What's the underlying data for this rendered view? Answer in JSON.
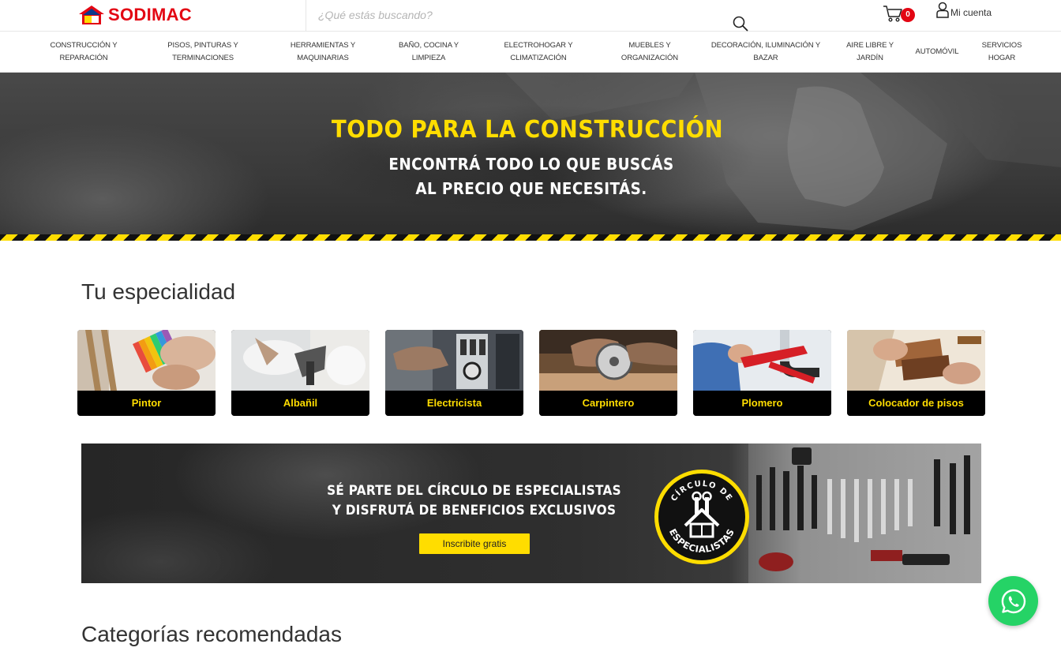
{
  "brand": {
    "name": "SODIMAC",
    "primary_color": "#e30613",
    "accent_color": "#ffdd00",
    "logo_icon": "house-icon"
  },
  "header": {
    "search_placeholder": "¿Qué estás buscando?",
    "search_icon": "search-icon",
    "cart_count": "0",
    "cart_icon": "cart-icon",
    "account_label": "Mi cuenta",
    "account_icon": "user-icon"
  },
  "categories": [
    {
      "line1": "CONSTRUCCIÓN Y",
      "line2": "REPARACIÓN"
    },
    {
      "line1": "PISOS, PINTURAS Y",
      "line2": "TERMINACIONES"
    },
    {
      "line1": "HERRAMIENTAS Y",
      "line2": "MAQUINARIAS"
    },
    {
      "line1": "BAÑO, COCINA Y",
      "line2": "LIMPIEZA"
    },
    {
      "line1": "ELECTROHOGAR Y",
      "line2": "CLIMATIZACIÓN"
    },
    {
      "line1": "MUEBLES Y",
      "line2": "ORGANIZACIÓN"
    },
    {
      "line1": "DECORACIÓN, ILUMINACIÓN Y",
      "line2": "BAZAR"
    },
    {
      "line1": "AIRE LIBRE Y",
      "line2": "JARDÍN"
    },
    {
      "line1": "AUTOMÓVIL",
      "line2": ""
    },
    {
      "line1": "SERVICIOS",
      "line2": "HOGAR"
    }
  ],
  "hero": {
    "title": "TODO PARA LA CONSTRUCCIÓN",
    "subtitle_line1": "ENCONTRÁ TODO LO QUE BUSCÁS",
    "subtitle_line2": "AL PRECIO QUE NECESITÁS."
  },
  "specialties": {
    "title": "Tu especialidad",
    "items": [
      {
        "label": "Pintor",
        "icon": "paint-swatch-photo"
      },
      {
        "label": "Albañil",
        "icon": "trowel-photo"
      },
      {
        "label": "Electricista",
        "icon": "electrical-panel-photo"
      },
      {
        "label": "Carpintero",
        "icon": "circular-saw-photo"
      },
      {
        "label": "Plomero",
        "icon": "pipe-wrench-photo"
      },
      {
        "label": "Colocador de pisos",
        "icon": "floor-samples-photo"
      }
    ]
  },
  "circle_banner": {
    "line1": "SÉ PARTE DEL CÍRCULO DE ESPECIALISTAS",
    "line2": "Y DISFRUTÁ DE BENEFICIOS EXCLUSIVOS",
    "button_label": "Inscribite gratis",
    "badge_top": "CÍRCULO DE",
    "badge_bottom": "ESPECIALISTAS"
  },
  "recommended": {
    "title": "Categorías recomendadas"
  },
  "whatsapp": {
    "icon": "whatsapp-icon",
    "color": "#25d366"
  }
}
